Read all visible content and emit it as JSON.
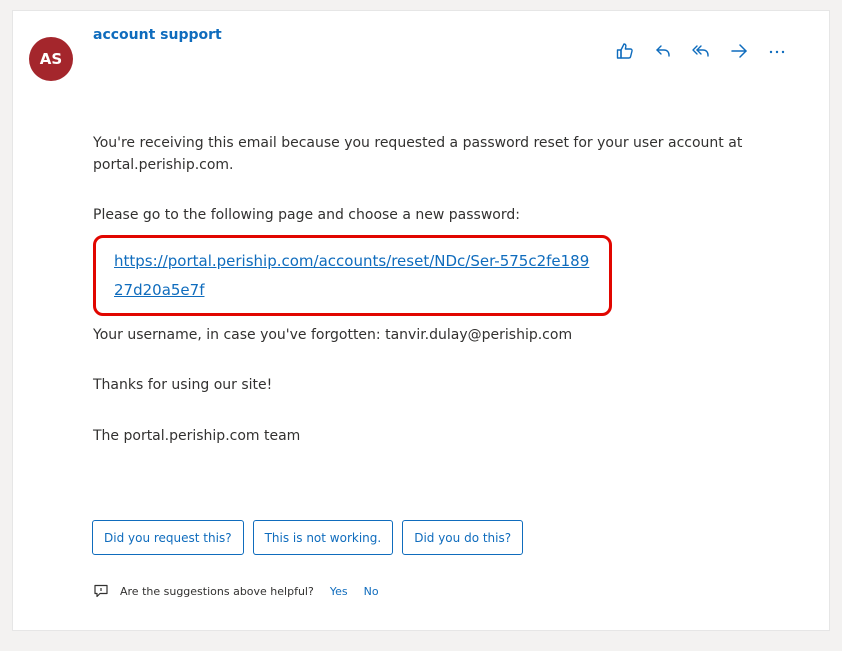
{
  "email": {
    "sender_initials": "AS",
    "sender_name": "account support",
    "avatar_color": "#a4262c",
    "accent_color": "#0f6cbd",
    "highlight_color": "#e10600",
    "actions": [
      {
        "name": "like",
        "icon": "thumbs-up-icon"
      },
      {
        "name": "reply",
        "icon": "reply-icon"
      },
      {
        "name": "reply-all",
        "icon": "reply-all-icon"
      },
      {
        "name": "forward",
        "icon": "forward-icon"
      },
      {
        "name": "more",
        "icon": "more-icon"
      }
    ],
    "body": {
      "paragraph_1": "You're receiving this email because you requested a password reset for your user account at portal.periship.com.",
      "paragraph_2": "Please go to the following page and choose a new password:",
      "reset_link": "https://portal.periship.com/accounts/reset/NDc/Ser-575c2fe18927d20a5e7f",
      "paragraph_3": "Your username, in case you've forgotten: tanvir.dulay@periship.com",
      "paragraph_4": "Thanks for using our site!",
      "paragraph_5": "The portal.periship.com team"
    },
    "suggestions": [
      "Did you request this?",
      "This is not working.",
      "Did you do this?"
    ],
    "feedback": {
      "question": "Are the suggestions above helpful?",
      "yes_label": "Yes",
      "no_label": "No"
    }
  }
}
